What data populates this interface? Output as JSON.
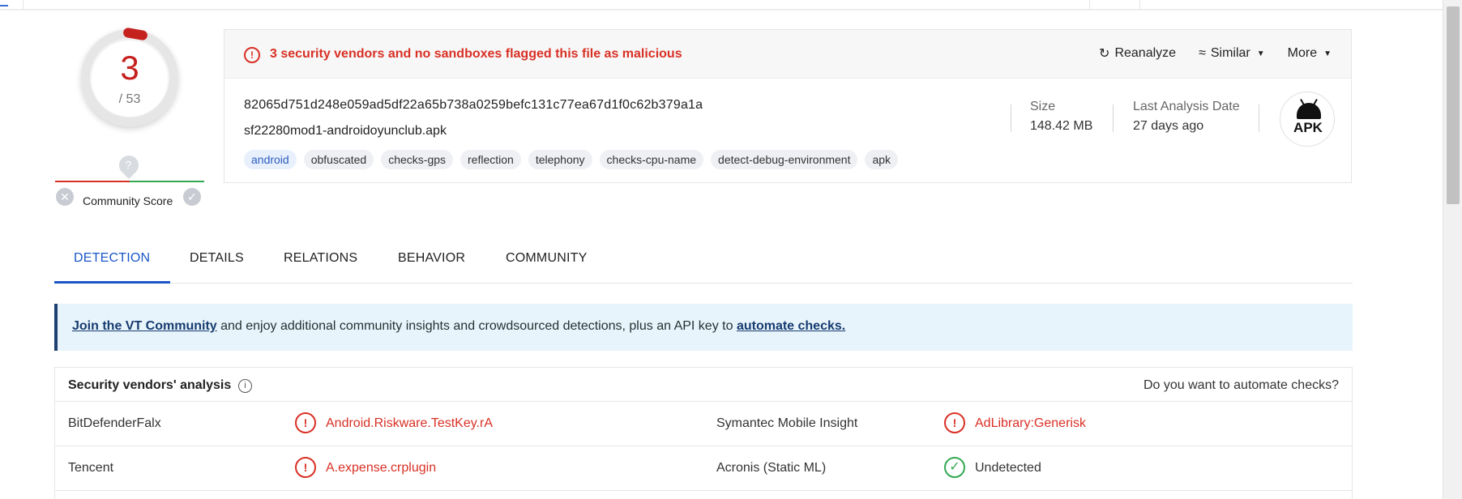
{
  "colors": {
    "malicious": "#d93025",
    "ok": "#34a853",
    "accent": "#1a56c8",
    "banner_bg": "#e8f4fb"
  },
  "score": {
    "value": "3",
    "total": "/ 53"
  },
  "community": {
    "label": "Community Score",
    "question_mark": "?"
  },
  "summary": {
    "alert": "3 security vendors and no sandboxes flagged this file as malicious",
    "actions": {
      "reanalyze": "Reanalyze",
      "similar": "Similar",
      "more": "More"
    },
    "hash": "82065d751d248e059ad5df22a65b738a0259befc131c77ea67d1f0c62b379a1a",
    "filename": "sf22280mod1-androidoyunclub.apk",
    "tags": [
      "android",
      "obfuscated",
      "checks-gps",
      "reflection",
      "telephony",
      "checks-cpu-name",
      "detect-debug-environment",
      "apk"
    ],
    "size_label": "Size",
    "size_value": "148.42 MB",
    "date_label": "Last Analysis Date",
    "date_value": "27 days ago",
    "filetype": "APK"
  },
  "tabs": {
    "detection": "DETECTION",
    "details": "DETAILS",
    "relations": "RELATIONS",
    "behavior": "BEHAVIOR",
    "community": "COMMUNITY"
  },
  "banner": {
    "join_link": "Join the VT Community",
    "middle_text": " and enjoy additional community insights and crowdsourced detections, plus an API key to ",
    "automate_link": "automate checks."
  },
  "vendors": {
    "title": "Security vendors' analysis",
    "automate_prompt": "Do you want to automate checks?",
    "rows": [
      {
        "left_vendor": "BitDefenderFalx",
        "left_result": "Android.Riskware.TestKey.rA",
        "right_vendor": "Symantec Mobile Insight",
        "right_result": "AdLibrary:Generisk"
      },
      {
        "left_vendor": "Tencent",
        "left_result": "A.expense.crplugin",
        "right_vendor": "Acronis (Static ML)",
        "right_result": "Undetected"
      }
    ]
  }
}
